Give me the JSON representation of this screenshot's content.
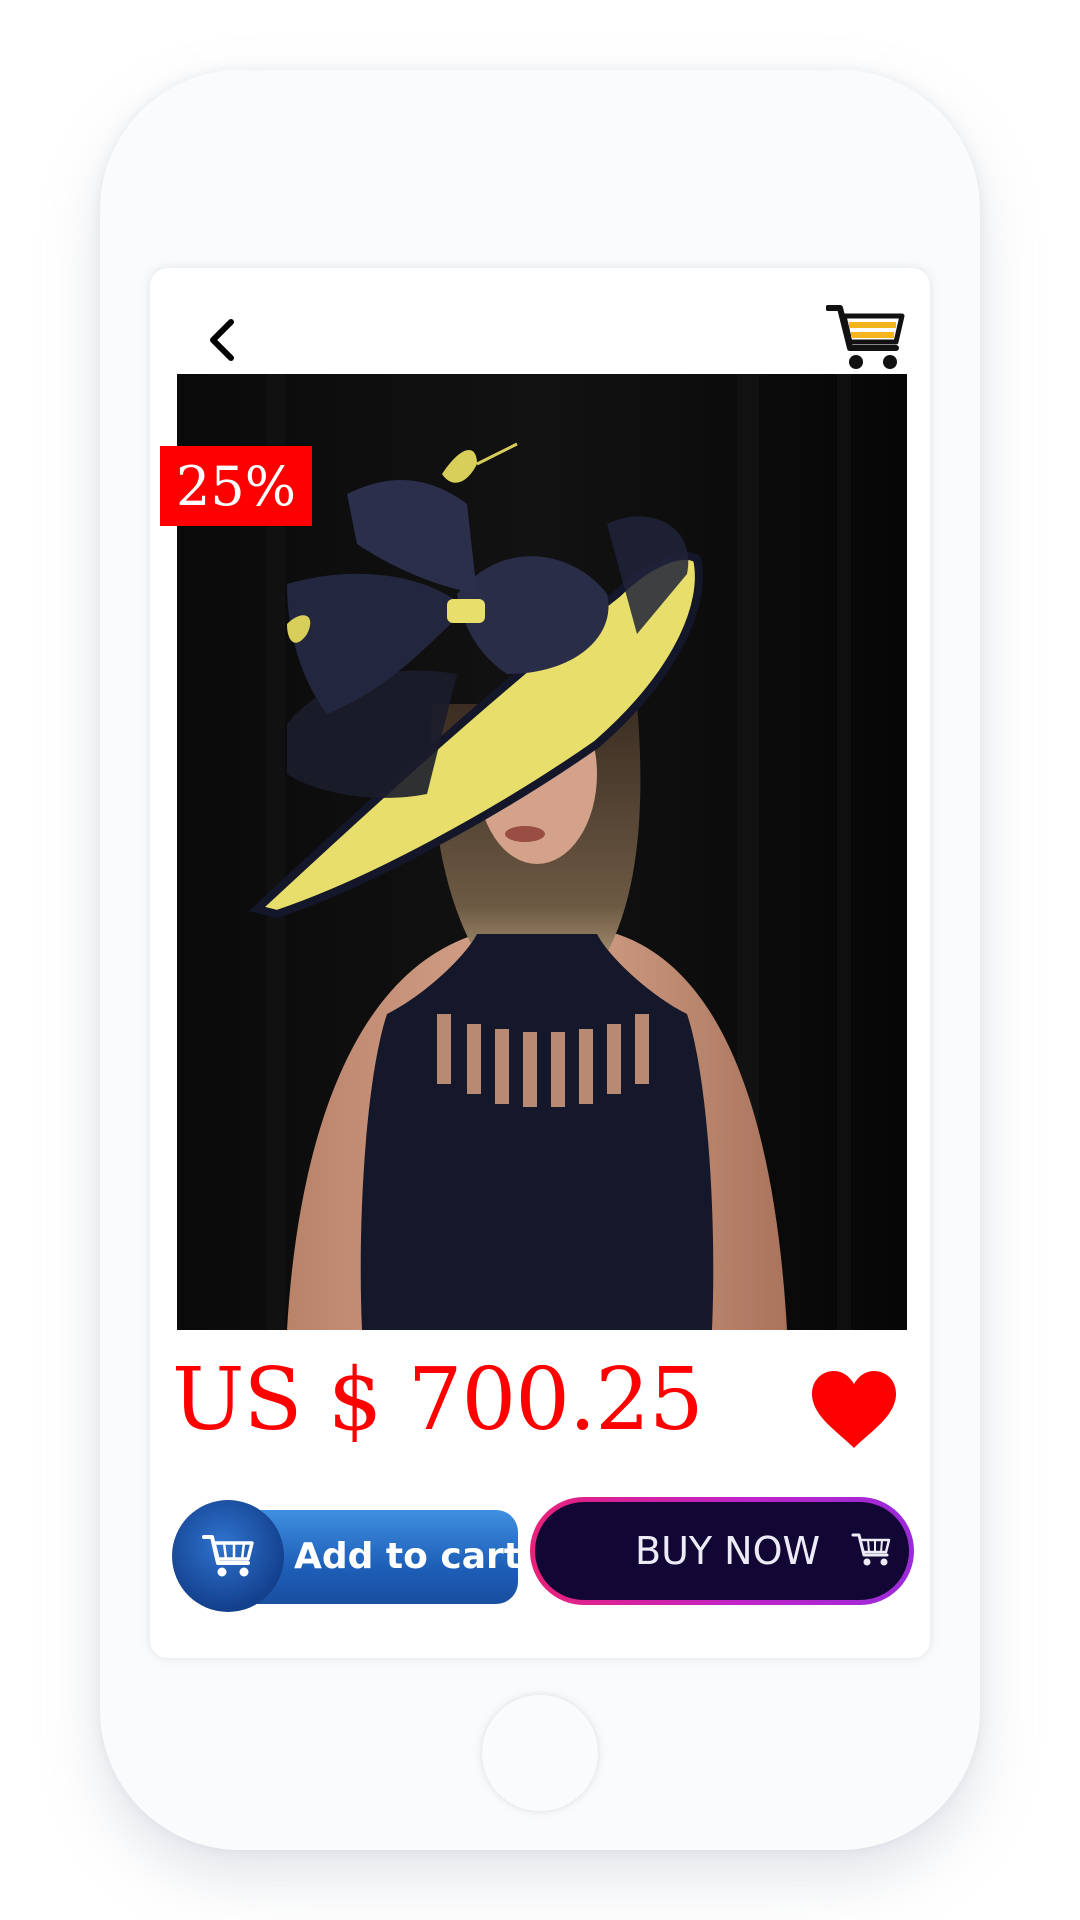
{
  "product": {
    "discount_badge": "25%",
    "price": "US $ 700.25",
    "image_icon": "product-photo"
  },
  "nav": {
    "back_icon": "chevron-left-icon",
    "cart_icon": "shopping-cart-icon"
  },
  "actions": {
    "add_to_cart_label": "Add to cart",
    "buy_now_label": "BUY NOW",
    "favorite_icon": "heart-icon"
  },
  "colors": {
    "accent_red": "#ff0000",
    "cart_yellow": "#f6b51e",
    "add_cart_blue": "#1e5fb8",
    "buy_now_dark": "#120734",
    "buy_now_border": "#e8227a"
  }
}
